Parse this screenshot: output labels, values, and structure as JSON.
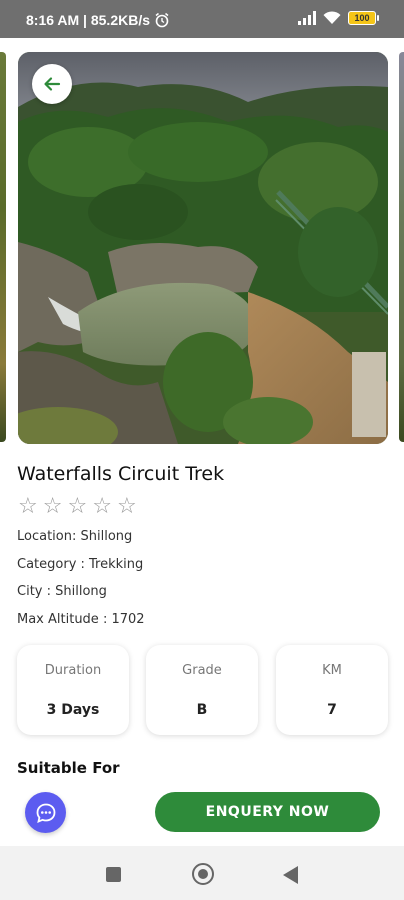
{
  "status_bar": {
    "time_and_speed": "8:16 AM | 85.2KB/s",
    "battery_level": "100"
  },
  "trek": {
    "title": "Waterfalls Circuit Trek",
    "rating": 0,
    "rating_max": 5,
    "location": "Location: Shillong",
    "category": "Category : Trekking",
    "city": "City : Shillong",
    "max_altitude": "Max Altitude : 1702"
  },
  "stats": [
    {
      "label": "Duration",
      "value": "3 Days"
    },
    {
      "label": "Grade",
      "value": "B"
    },
    {
      "label": "KM",
      "value": "7"
    }
  ],
  "suitable_for_heading": "Suitable For",
  "actions": {
    "enquiry_label": "ENQUERY NOW"
  },
  "colors": {
    "accent_green": "#2e8b3a",
    "chat_fab": "#5c5cf0",
    "status_bar": "#6f6f6f"
  },
  "icons": [
    "alarm-icon",
    "signal-icon",
    "wifi-icon",
    "battery-icon",
    "back-arrow-icon",
    "star-outline-icon",
    "chat-icon",
    "recent-apps-icon",
    "home-icon",
    "nav-back-icon"
  ]
}
